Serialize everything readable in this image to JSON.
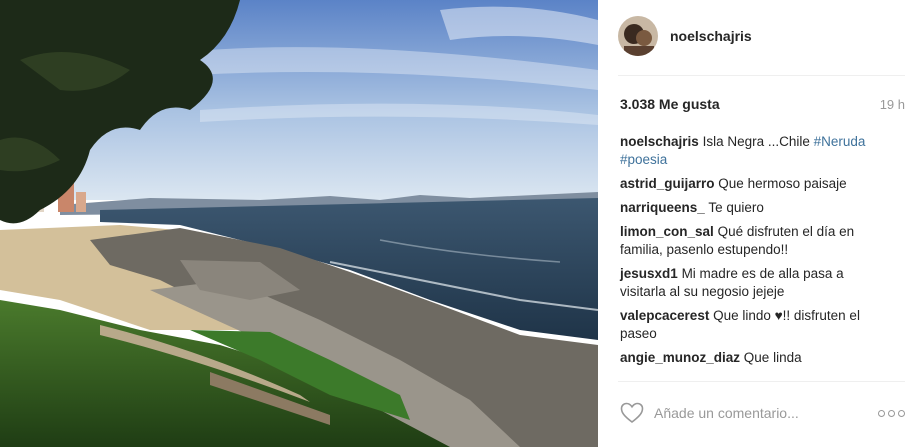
{
  "post": {
    "username": "noelschajris",
    "likes_text": "3.038 Me gusta",
    "time_ago": "19 h",
    "caption": {
      "username": "noelschajris",
      "text": "Isla Negra ...Chile",
      "hashtags": [
        "#Neruda",
        "#poesia"
      ]
    },
    "comments": [
      {
        "username": "astrid_guijarro",
        "text": "Que hermoso paisaje"
      },
      {
        "username": "narriqueens_",
        "text": "Te quiero"
      },
      {
        "username": "limon_con_sal",
        "text": "Qué disfruten el día en familia, pasenlo estupendo!!"
      },
      {
        "username": "jesusxd1",
        "text": "Mi madre es de alla pasa a visitarla al su negosio jejeje"
      },
      {
        "username": "valepcacerest",
        "text": "Que lindo ♥!! disfruten el paseo"
      },
      {
        "username": "angie_munoz_diaz",
        "text": "Que linda"
      }
    ],
    "add_comment_placeholder": "Añade un comentario...",
    "icons": {
      "like": "heart-icon",
      "more": "more-options-icon"
    }
  }
}
